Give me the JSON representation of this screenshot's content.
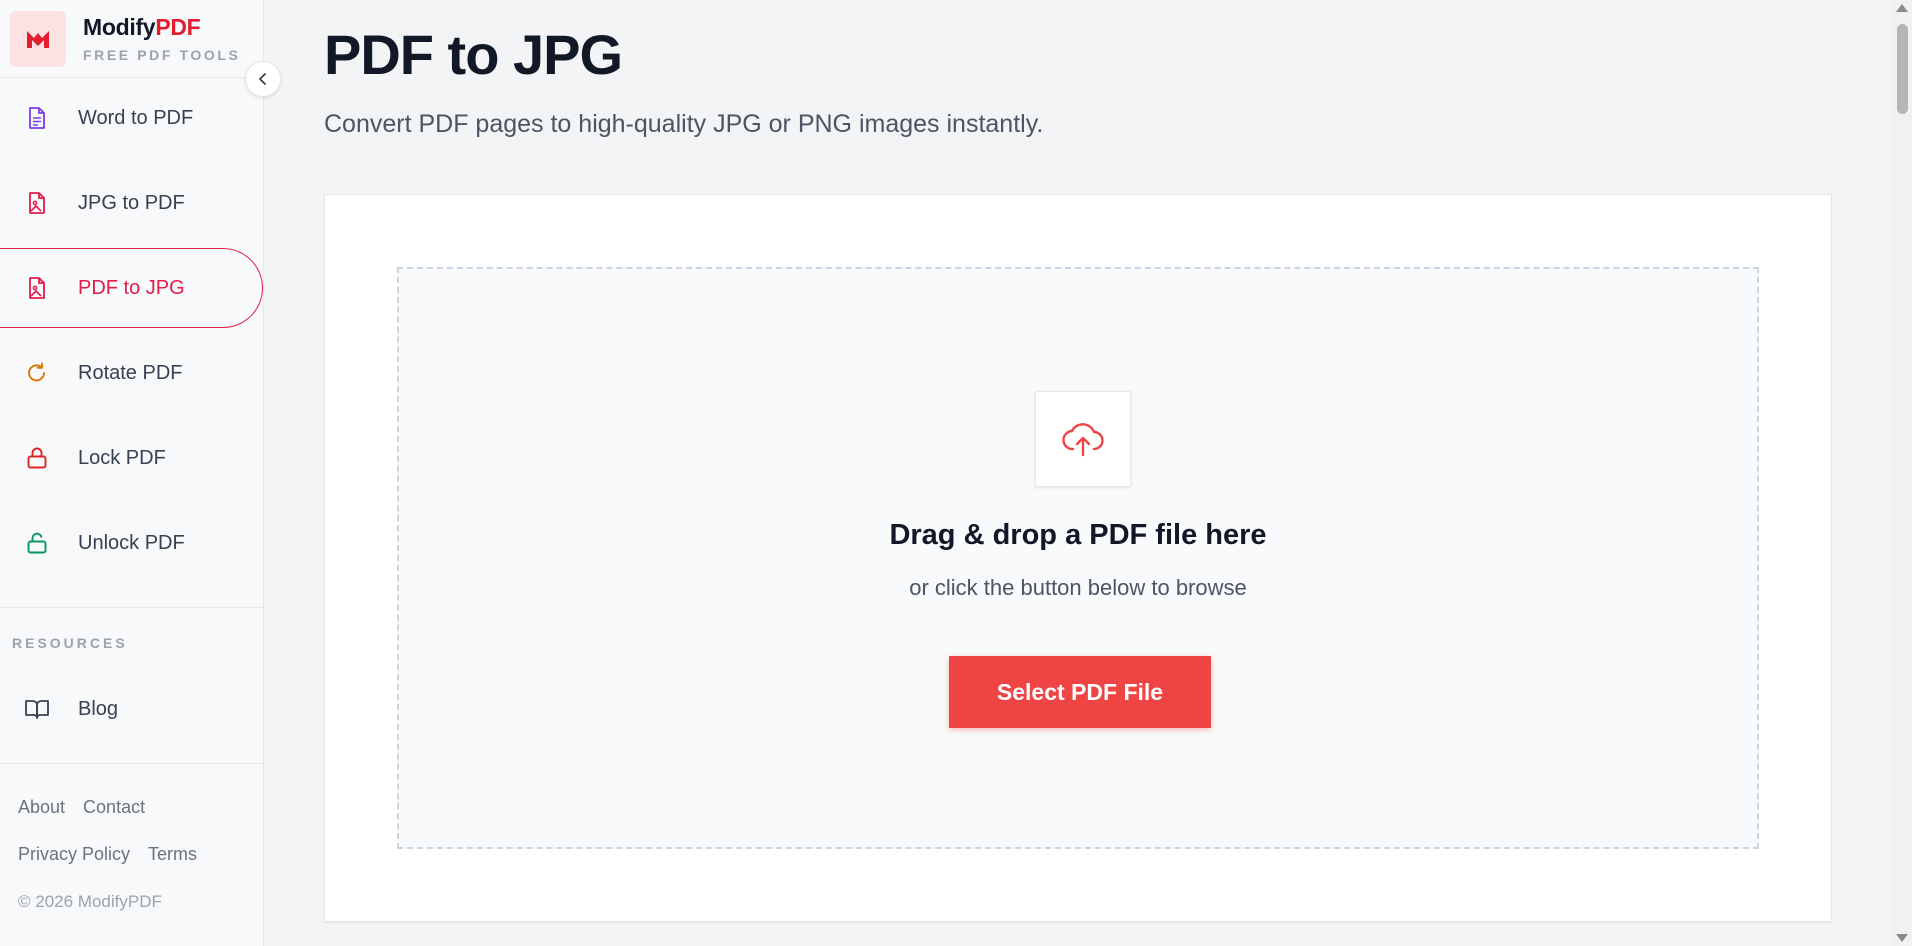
{
  "brand": {
    "name_main": "Modify",
    "name_accent": "PDF",
    "tagline": "FREE PDF TOOLS",
    "logo_icon": "modifypdf-logo-icon"
  },
  "sidebar": {
    "items": [
      {
        "label": "Word to PDF",
        "icon": "file-text-icon",
        "color": "#7c3aed"
      },
      {
        "label": "JPG to PDF",
        "icon": "file-image-icon",
        "color": "#e11d48"
      },
      {
        "label": "PDF to JPG",
        "icon": "file-image-icon",
        "color": "#e11d48",
        "active": true
      },
      {
        "label": "Rotate PDF",
        "icon": "rotate-icon",
        "color": "#d97706"
      },
      {
        "label": "Lock PDF",
        "icon": "lock-icon",
        "color": "#dc2626"
      },
      {
        "label": "Unlock PDF",
        "icon": "unlock-icon",
        "color": "#059669"
      }
    ],
    "resources_label": "RESOURCES",
    "blog": {
      "label": "Blog",
      "icon": "book-open-icon"
    },
    "footer": {
      "about": "About",
      "contact": "Contact",
      "privacy": "Privacy Policy",
      "terms": "Terms",
      "copyright": "© 2026 ModifyPDF"
    }
  },
  "main": {
    "title": "PDF to JPG",
    "subtitle": "Convert PDF pages to high-quality JPG or PNG images instantly.",
    "dropzone": {
      "icon": "cloud-upload-icon",
      "title": "Drag & drop a PDF file here",
      "subtitle": "or click the button below to browse",
      "button_label": "Select PDF File"
    }
  },
  "colors": {
    "accent": "#ef4444",
    "brand_red": "#e11d2e",
    "active_nav": "#e11d48"
  }
}
